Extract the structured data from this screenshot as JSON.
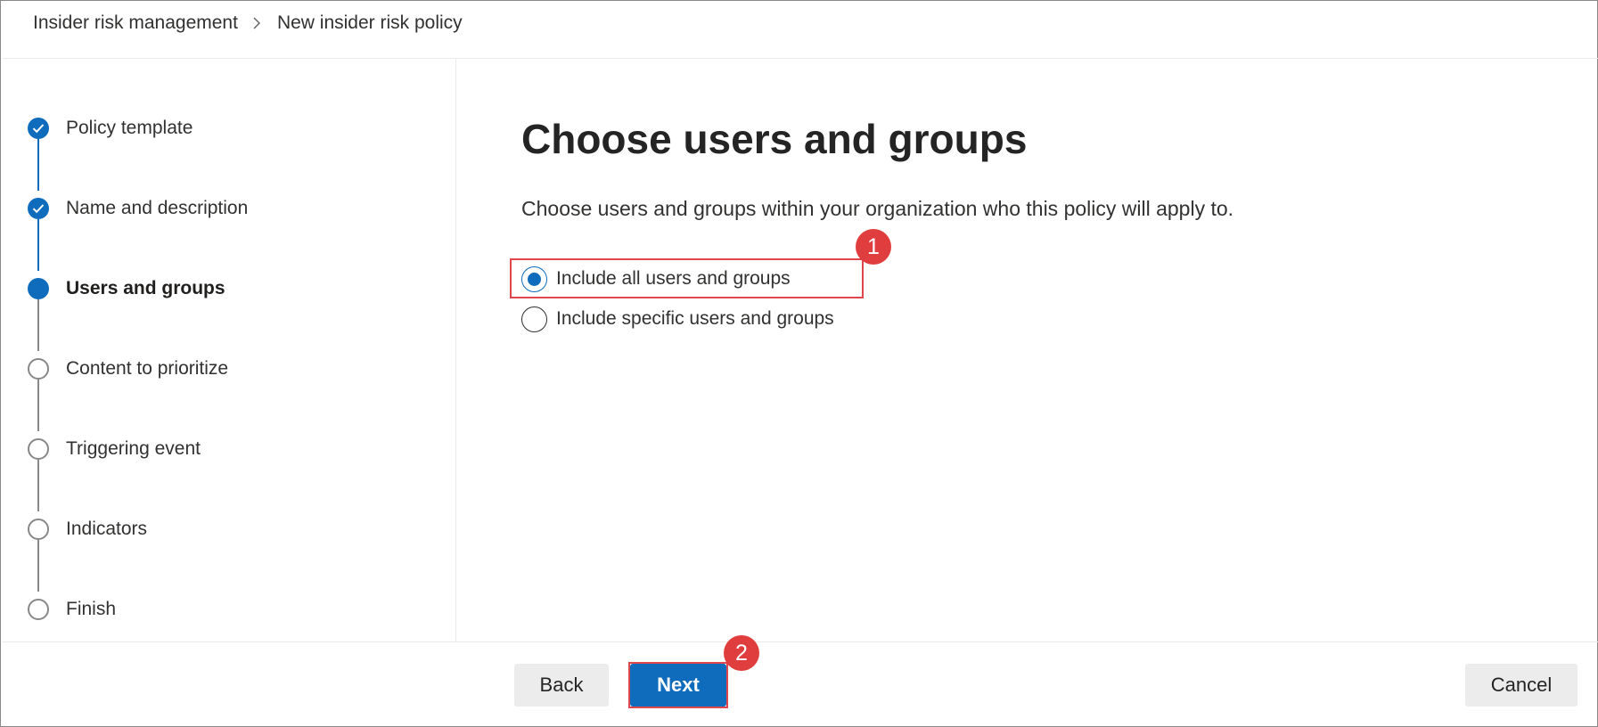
{
  "breadcrumb": {
    "items": [
      "Insider risk management",
      "New insider risk policy"
    ],
    "separator_icon": "chevron-right-icon"
  },
  "steps": [
    {
      "label": "Policy template",
      "state": "completed"
    },
    {
      "label": "Name and description",
      "state": "completed"
    },
    {
      "label": "Users and groups",
      "state": "current"
    },
    {
      "label": "Content to prioritize",
      "state": "not-started"
    },
    {
      "label": "Triggering event",
      "state": "not-started"
    },
    {
      "label": "Indicators",
      "state": "not-started"
    },
    {
      "label": "Finish",
      "state": "not-started"
    }
  ],
  "main": {
    "title": "Choose users and groups",
    "description": "Choose users and groups within your organization who this policy will apply to.",
    "options": [
      {
        "label": "Include all users and groups",
        "selected": true
      },
      {
        "label": "Include specific users and groups",
        "selected": false
      }
    ]
  },
  "annotations": {
    "badge1": "1",
    "badge2": "2"
  },
  "footer": {
    "back_label": "Back",
    "next_label": "Next",
    "cancel_label": "Cancel"
  },
  "colors": {
    "accent": "#0f6cbd",
    "annotation_red": "#e03e3e",
    "pending_gray": "#8a8886"
  }
}
